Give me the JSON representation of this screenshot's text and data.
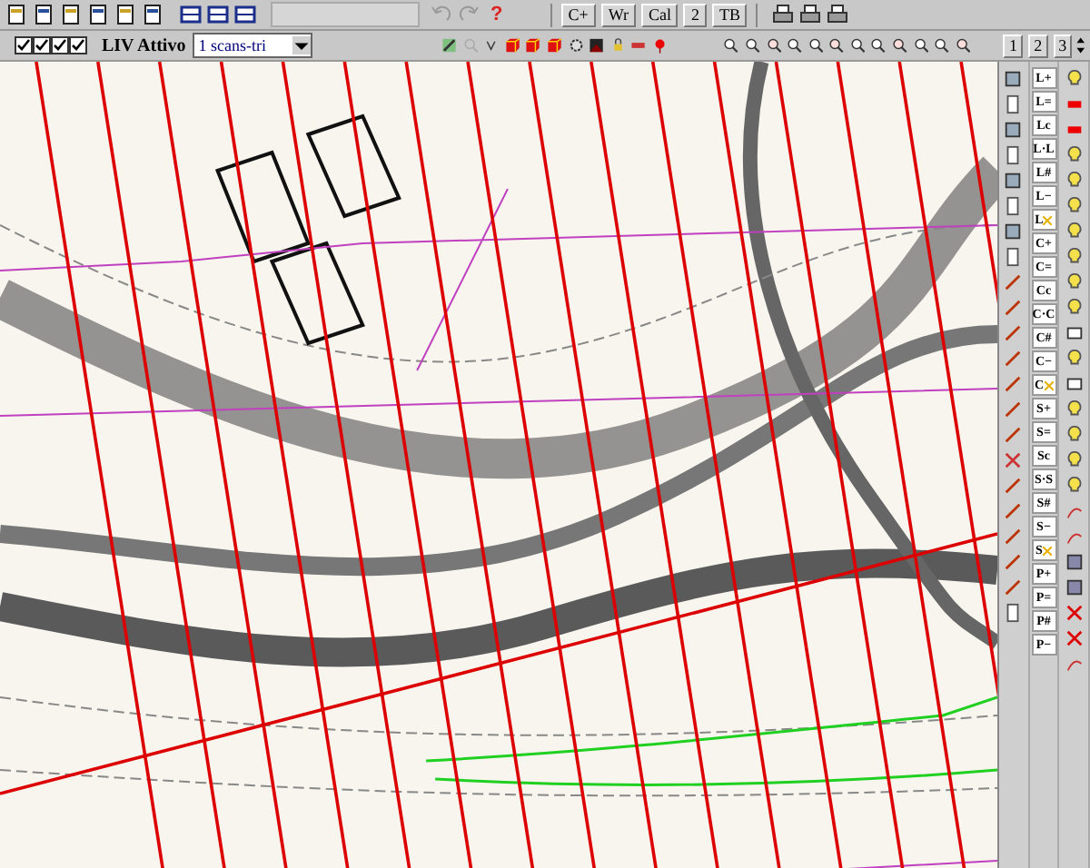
{
  "toolbar_top": {
    "help": "?",
    "buttons": [
      "C+",
      "Wr",
      "Cal",
      "2",
      "TB"
    ]
  },
  "toolbar_layers": {
    "checkboxes": [
      {
        "checked": true
      },
      {
        "checked": true
      },
      {
        "checked": true
      },
      {
        "checked": true
      }
    ],
    "label": "LIV Attivo",
    "layer_select": "1 scans-tri",
    "page_buttons": [
      "1",
      "2",
      "3"
    ]
  },
  "side_panel": {
    "tools": [
      {
        "kind": "text",
        "label": "L+"
      },
      {
        "kind": "text",
        "label": "L="
      },
      {
        "kind": "text",
        "label": "Lc"
      },
      {
        "kind": "text",
        "label": "L·L"
      },
      {
        "kind": "text",
        "label": "L#"
      },
      {
        "kind": "text",
        "label": "L−"
      },
      {
        "kind": "delete",
        "label": "L"
      },
      {
        "kind": "text",
        "label": "C+"
      },
      {
        "kind": "text",
        "label": "C="
      },
      {
        "kind": "text",
        "label": "Cc"
      },
      {
        "kind": "text",
        "label": "C·C"
      },
      {
        "kind": "text",
        "label": "C#"
      },
      {
        "kind": "text",
        "label": "C−"
      },
      {
        "kind": "delete",
        "label": "C"
      },
      {
        "kind": "text",
        "label": "S+"
      },
      {
        "kind": "text",
        "label": "S="
      },
      {
        "kind": "text",
        "label": "Sc"
      },
      {
        "kind": "text",
        "label": "S·S"
      },
      {
        "kind": "text",
        "label": "S#"
      },
      {
        "kind": "text",
        "label": "S−"
      },
      {
        "kind": "delete",
        "label": "S"
      },
      {
        "kind": "text",
        "label": "P+"
      },
      {
        "kind": "text",
        "label": "P="
      },
      {
        "kind": "text",
        "label": "P#"
      },
      {
        "kind": "text",
        "label": "P−"
      }
    ]
  }
}
